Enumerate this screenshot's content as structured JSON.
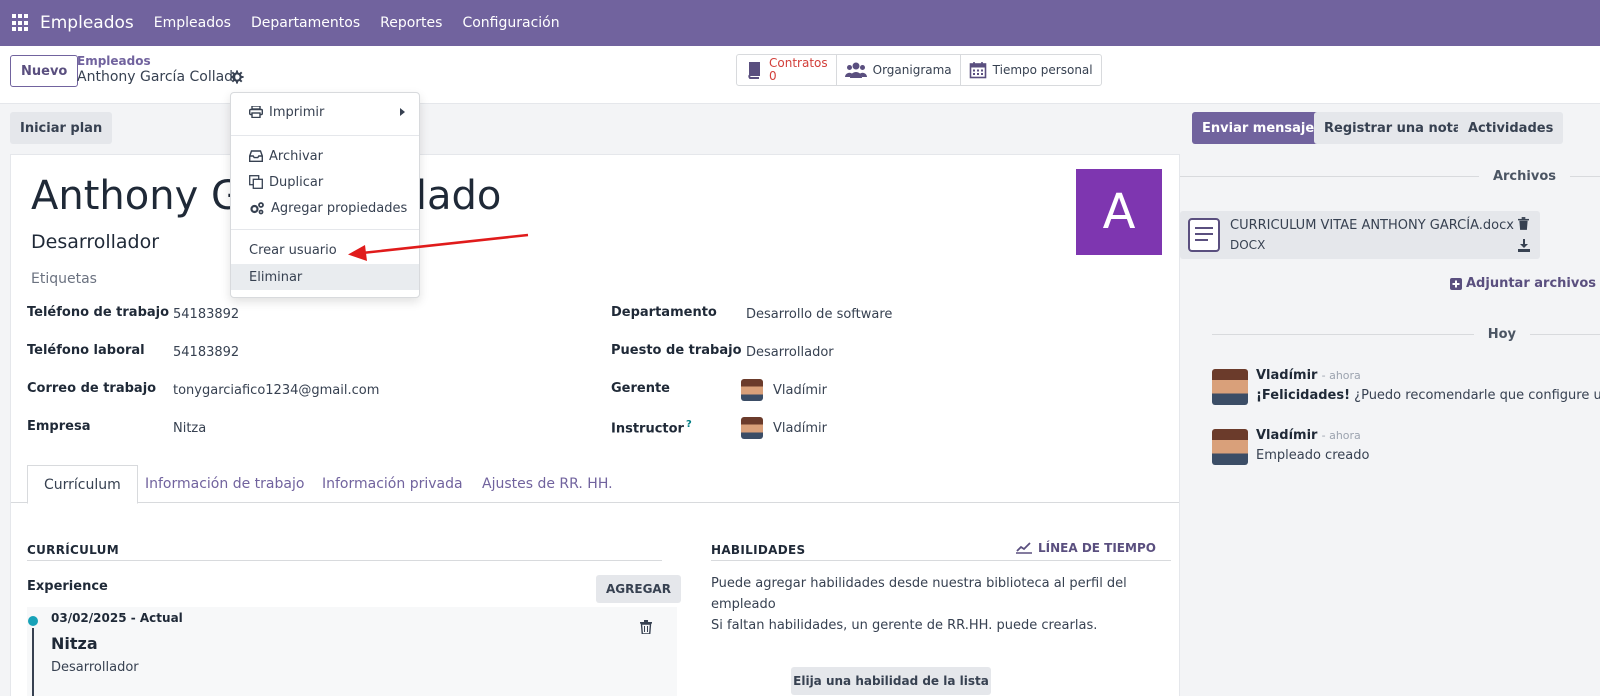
{
  "topnav": {
    "app_name": "Empleados",
    "menu": [
      "Empleados",
      "Departamentos",
      "Reportes",
      "Configuración"
    ]
  },
  "control_panel": {
    "new_label": "Nuevo",
    "breadcrumb_parent": "Empleados",
    "breadcrumb_current": "Anthony García Collado",
    "smart_buttons": {
      "contracts_label": "Contratos",
      "contracts_count": "0",
      "org_chart_label": "Organigrama",
      "time_off_label": "Tiempo personal"
    }
  },
  "gear_menu": {
    "print": "Imprimir",
    "archive": "Archivar",
    "duplicate": "Duplicar",
    "add_properties": "Agregar propiedades",
    "create_user": "Crear usuario",
    "delete": "Eliminar"
  },
  "status_bar": {
    "start_plan": "Iniciar plan"
  },
  "chatter_actions": {
    "send_message": "Enviar mensaje",
    "log_note": "Registrar una nota",
    "activities": "Actividades"
  },
  "employee": {
    "name": "Anthony García Collado",
    "job_title": "Desarrollador",
    "tags_placeholder": "Etiquetas",
    "avatar_letter": "A",
    "avatar_color": "#7e36b0"
  },
  "fields": {
    "work_phone_label": "Teléfono de trabajo",
    "work_phone": "54183892",
    "mobile_label": "Teléfono laboral",
    "mobile": "54183892",
    "email_label": "Correo de trabajo",
    "email": "tonygarciafico1234@gmail.com",
    "company_label": "Empresa",
    "company": "Nitza",
    "department_label": "Departamento",
    "department": "Desarrollo de software",
    "job_position_label": "Puesto de trabajo",
    "job_position": "Desarrollador",
    "manager_label": "Gerente",
    "manager": "Vladímir",
    "coach_label": "Instructor",
    "coach_help": "?",
    "coach": "Vladímir"
  },
  "tabs": [
    "Currículum",
    "Información de trabajo",
    "Información privada",
    "Ajustes de RR. HH."
  ],
  "resume": {
    "section_title": "CURRÍCULUM",
    "experience_label": "Experience",
    "add_label": "AGREGAR",
    "entry": {
      "dates": "03/02/2025 - Actual",
      "company": "Nitza",
      "role": "Desarrollador"
    }
  },
  "skills": {
    "section_title": "HABILIDADES",
    "timeline_label": "LÍNEA DE TIEMPO",
    "help_line1": "Puede agregar habilidades desde nuestra biblioteca al perfil del empleado",
    "help_line2": "Si faltan habilidades, un gerente de RR.HH. puede crearlas.",
    "choose_label": "Elija una habilidad de la lista"
  },
  "chatter": {
    "files_title": "Archivos",
    "attachment_name": "CURRICULUM VITAE ANTHONY GARCÍA.docx",
    "attachment_type": "DOCX",
    "attach_label": "Adjuntar archivos",
    "today_label": "Hoy",
    "messages": [
      {
        "author": "Vladímir",
        "time": "- ahora",
        "bold": "¡Felicidades!",
        "body": " ¿Puedo recomendarle que configure unpl"
      },
      {
        "author": "Vladímir",
        "time": "- ahora",
        "bold": "",
        "body": "Empleado creado"
      }
    ]
  },
  "colors": {
    "brand": "#71639e",
    "annotation_arrow": "#e01b1b"
  }
}
